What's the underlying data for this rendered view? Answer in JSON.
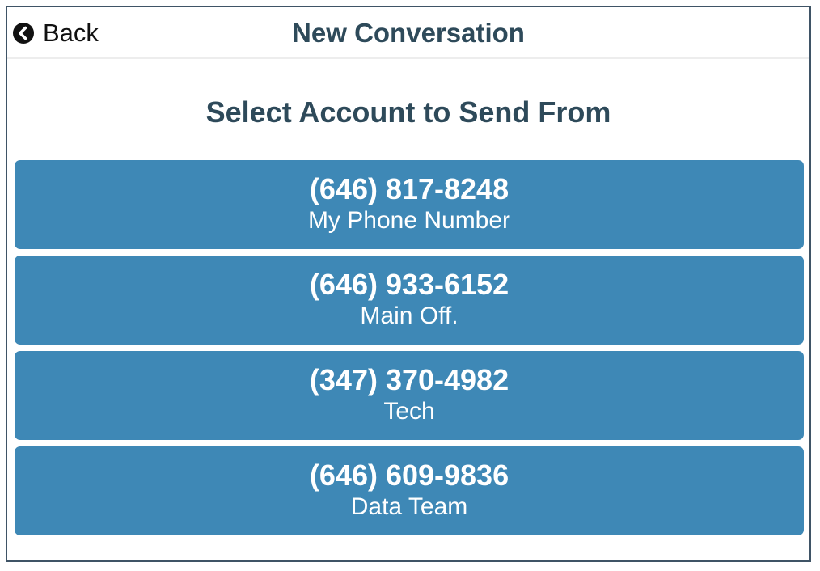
{
  "header": {
    "back_label": "Back",
    "back_icon": "chevron-left-circle-icon",
    "title": "New Conversation"
  },
  "main": {
    "section_title": "Select Account to Send From",
    "accounts": [
      {
        "number": "(646) 817-8248",
        "label": "My Phone Number"
      },
      {
        "number": "(646) 933-6152",
        "label": "Main Off."
      },
      {
        "number": "(347) 370-4982",
        "label": "Tech"
      },
      {
        "number": "(646) 609-9836",
        "label": "Data Team"
      }
    ]
  },
  "colors": {
    "button_bg": "#3e88b6",
    "title_text": "#2e4a5a",
    "frame_border": "#3f5466"
  }
}
